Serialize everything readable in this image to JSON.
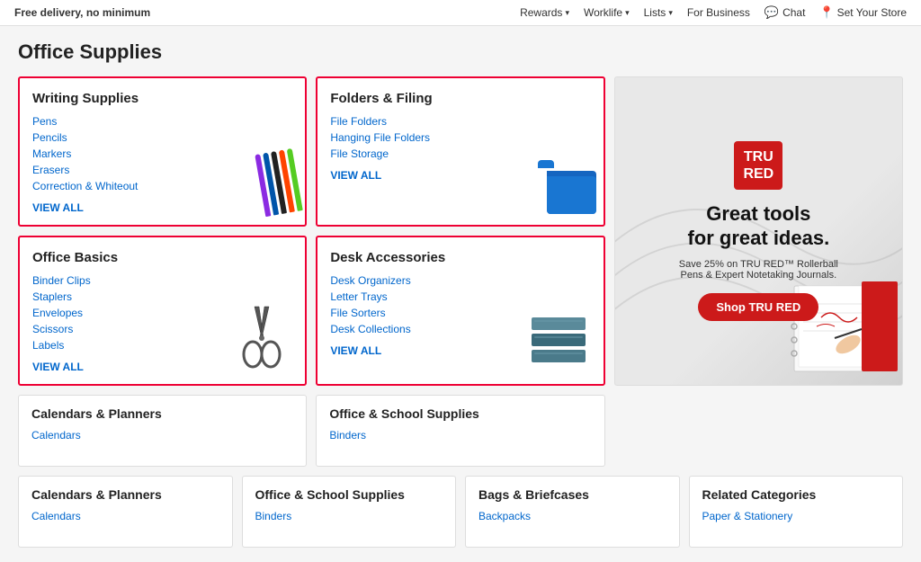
{
  "topNav": {
    "promo": "Free delivery, no minimum",
    "items": [
      {
        "label": "Rewards",
        "hasChevron": true
      },
      {
        "label": "Worklife",
        "hasChevron": true
      },
      {
        "label": "Lists",
        "hasChevron": true
      },
      {
        "label": "For Business",
        "hasChevron": false
      },
      {
        "label": "Chat",
        "hasIcon": true
      },
      {
        "label": "Set Your Store",
        "hasIcon": true
      }
    ]
  },
  "page": {
    "title": "Office Supplies"
  },
  "cards": [
    {
      "id": "writing-supplies",
      "title": "Writing Supplies",
      "links": [
        "Pens",
        "Pencils",
        "Markers",
        "Erasers",
        "Correction & Whiteout"
      ],
      "viewAll": "VIEW ALL",
      "hasBorder": true
    },
    {
      "id": "folders-filing",
      "title": "Folders & Filing",
      "links": [
        "File Folders",
        "Hanging File Folders",
        "File Storage"
      ],
      "viewAll": "VIEW ALL",
      "hasBorder": true
    },
    {
      "id": "office-basics",
      "title": "Office Basics",
      "links": [
        "Binder Clips",
        "Staplers",
        "Envelopes",
        "Scissors",
        "Labels"
      ],
      "viewAll": "VIEW ALL",
      "hasBorder": true
    },
    {
      "id": "desk-accessories",
      "title": "Desk Accessories",
      "links": [
        "Desk Organizers",
        "Letter Trays",
        "File Sorters",
        "Desk Collections"
      ],
      "viewAll": "VIEW ALL",
      "hasBorder": true
    }
  ],
  "truRed": {
    "logo_line1": "TRU",
    "logo_line2": "RED",
    "headline_line1": "Great tools",
    "headline_line2": "for great ideas.",
    "subtext": "Save 25% on TRU RED™ Rollerball Pens & Expert Notetaking Journals.",
    "button": "Shop TRU RED"
  },
  "bottomCards": [
    {
      "id": "calendars-planners",
      "title": "Calendars & Planners",
      "links": [
        "Calendars"
      ]
    },
    {
      "id": "office-school-supplies",
      "title": "Office & School Supplies",
      "links": [
        "Binders"
      ]
    },
    {
      "id": "bags-briefcases",
      "title": "Bags & Briefcases",
      "links": [
        "Backpacks"
      ]
    },
    {
      "id": "related-categories",
      "title": "Related Categories",
      "links": [
        "Paper & Stationery"
      ]
    }
  ],
  "pens": [
    {
      "color": "#8B2BE2"
    },
    {
      "color": "#0055AA"
    },
    {
      "color": "#222222"
    },
    {
      "color": "#FF4400"
    },
    {
      "color": "#22AA22"
    }
  ]
}
